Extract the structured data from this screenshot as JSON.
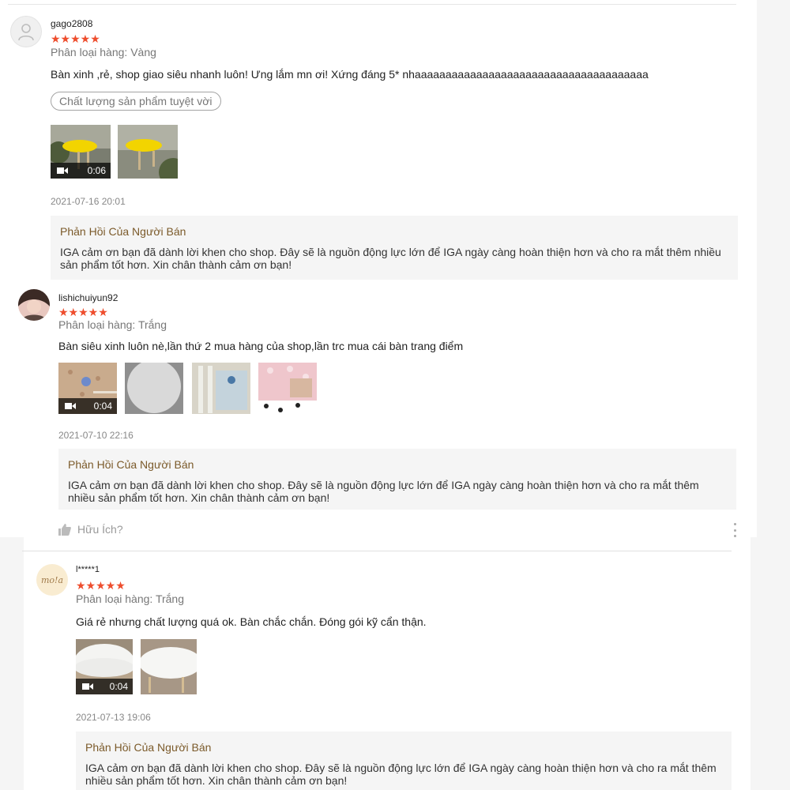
{
  "reviews": [
    {
      "username": "gago2808",
      "rating": 5,
      "variant": "Phân loại hàng: Vàng",
      "comment": "Bàn xinh ,rẻ, shop giao siêu nhanh luôn! Ưng lắm mn ơi! Xứng đáng 5* nhaaaaaaaaaaaaaaaaaaaaaaaaaaaaaaaaaaaaaa",
      "tag": "Chất lượng sản phẩm tuyệt vời",
      "video_duration": "0:06",
      "timestamp": "2021-07-16 20:01",
      "reply_title": "Phản Hồi Của Người Bán",
      "reply_text": "IGA cảm ơn bạn đã dành lời khen cho shop. Đây sẽ là nguồn động lực lớn để IGA ngày càng hoàn thiện hơn và cho ra mắt thêm nhiều sản phẩm tốt hơn. Xin chân thành cảm ơn bạn!"
    },
    {
      "username": "lishichuiyun92",
      "rating": 5,
      "variant": "Phân loại hàng: Trắng",
      "comment": "Bàn siêu xinh luôn nè,lần thứ 2 mua hàng của shop,lần trc mua cái bàn trang điểm",
      "video_duration": "0:04",
      "timestamp": "2021-07-10 22:16",
      "reply_title": "Phản Hồi Của Người Bán",
      "reply_text": "IGA cảm ơn bạn đã dành lời khen cho shop. Đây sẽ là nguồn động lực lớn để IGA ngày càng hoàn thiện hơn và cho ra mắt thêm nhiều sản phẩm tốt hơn. Xin chân thành cảm ơn bạn!",
      "helpful_label": "Hữu Ích?"
    },
    {
      "username": "l*****1",
      "avatar_text": "mo!a",
      "rating": 5,
      "variant": "Phân loại hàng: Trắng",
      "comment": "Giá rẻ nhưng chất lượng quá ok. Bàn chắc chắn. Đóng gói kỹ cẩn thận.",
      "video_duration": "0:04",
      "timestamp": "2021-07-13 19:06",
      "reply_title": "Phản Hồi Của Người Bán",
      "reply_text": "IGA cảm ơn bạn đã dành lời khen cho shop. Đây sẽ là nguồn động lực lớn để IGA ngày càng hoàn thiện hơn và cho ra mắt thêm nhiều sản phẩm tốt hơn. Xin chân thành cảm ơn bạn!"
    }
  ],
  "stars_glyph": "★★★★★",
  "colors": {
    "star": "#ee4d2d",
    "reply_title": "#7b5a2a",
    "reply_bg": "#f5f5f5"
  },
  "icons": {
    "video": "video-camera-icon",
    "helpful": "thumbs-up-icon",
    "more": "more-vertical-icon",
    "avatar_default": "user-icon"
  }
}
